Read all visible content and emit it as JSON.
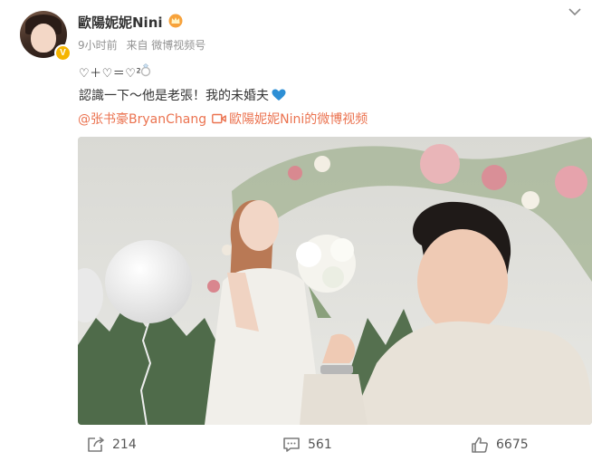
{
  "post": {
    "author": "歐陽妮妮Nini",
    "time": "9小时前",
    "source": "来自 微博视频号",
    "line1": "♡＋♡＝♡²",
    "line2": "認識一下～他是老張！我的未婚夫",
    "mention": "@张书豪BryanChang",
    "video_link": "歐陽妮妮Nini的微博视频"
  },
  "actions": {
    "repost_count": "214",
    "comment_count": "561",
    "like_count": "6675"
  },
  "icons": [
    "chevron-down-icon",
    "crown-icon",
    "verified-badge-icon",
    "ring-icon",
    "blue-heart-icon",
    "video-icon",
    "repost-icon",
    "comment-icon",
    "like-icon"
  ],
  "colors": {
    "link": "#eb7350",
    "text": "#333333",
    "meta": "#939393",
    "heart": "#2d8fd5",
    "badge": "#f5b400"
  }
}
